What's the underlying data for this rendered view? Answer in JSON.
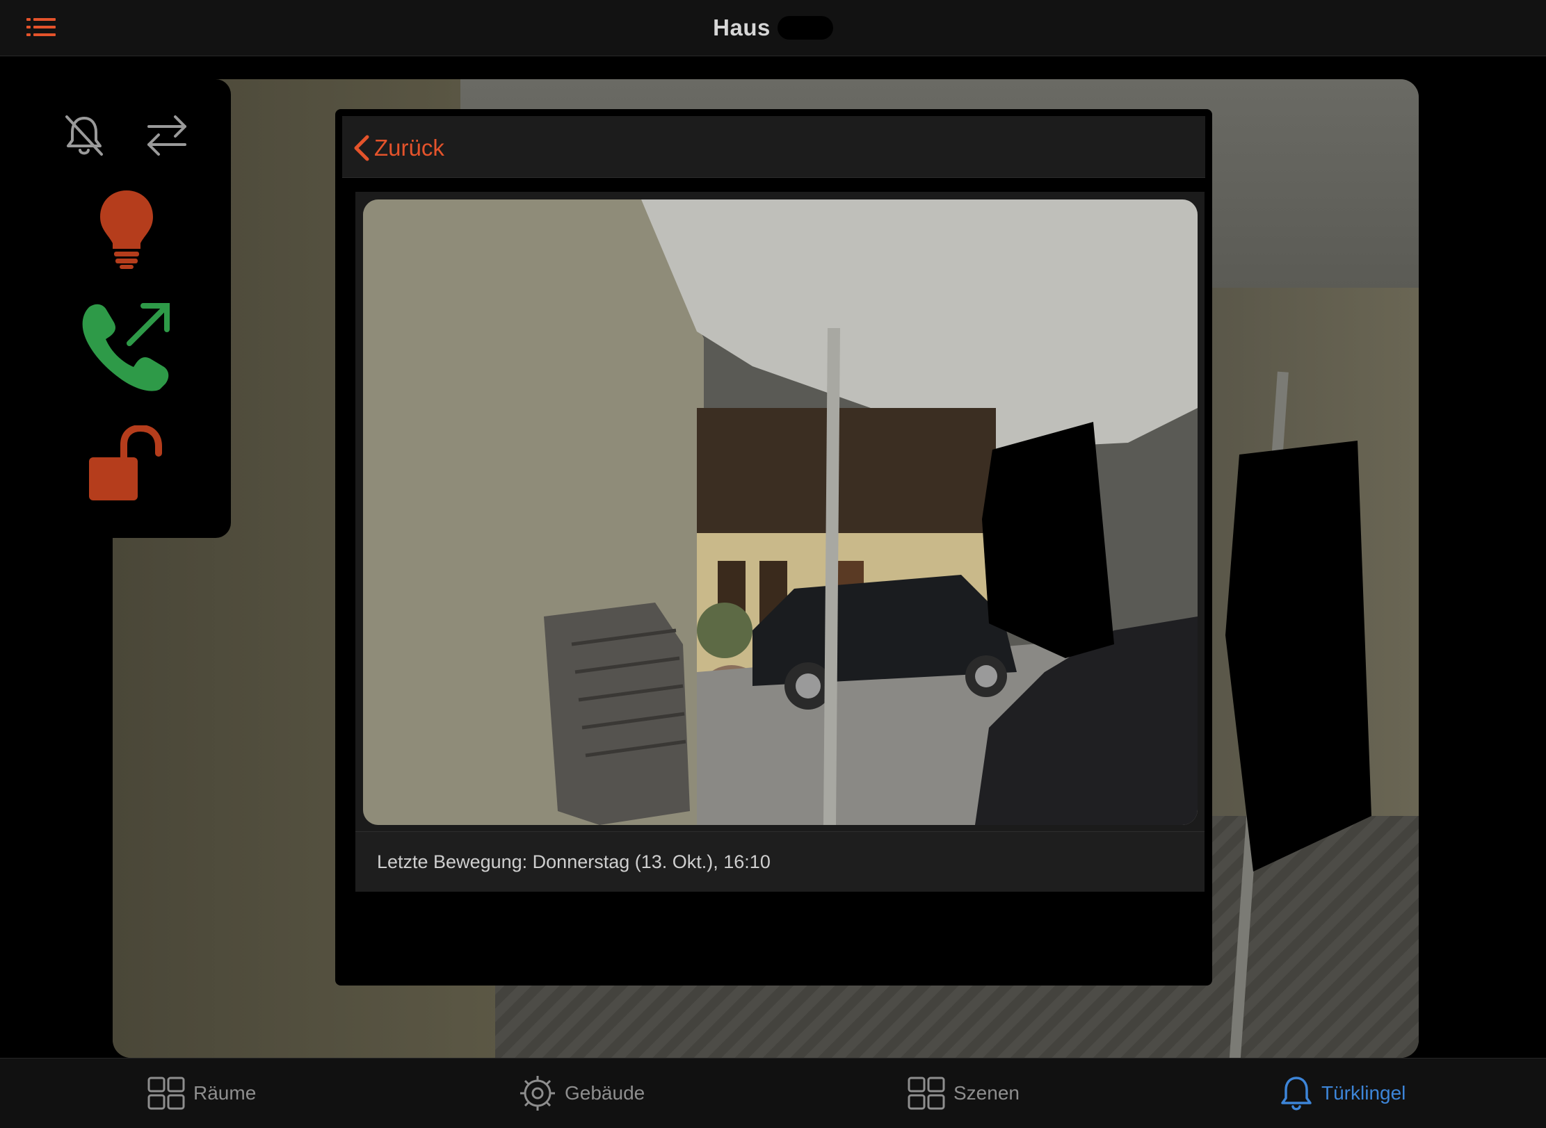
{
  "header": {
    "title": "Haus",
    "menu_icon": "list-icon"
  },
  "side_controls": [
    {
      "name": "bell-muted-icon",
      "color": "#9a9a9a"
    },
    {
      "name": "swap-arrows-icon",
      "color": "#9a9a9a"
    },
    {
      "name": "lightbulb-icon",
      "color": "#b53d1c"
    },
    {
      "name": "phone-outgoing-icon",
      "color": "#2e9a48"
    },
    {
      "name": "unlock-icon",
      "color": "#b53d1c"
    }
  ],
  "modal": {
    "back_label": "Zurück",
    "motion_text": "Letzte Bewegung: Donnerstag (13. Okt.), 16:10"
  },
  "tabbar": {
    "tabs": [
      {
        "label": "Räume",
        "icon": "grid-icon",
        "active": false
      },
      {
        "label": "Gebäude",
        "icon": "gear-icon",
        "active": false
      },
      {
        "label": "Szenen",
        "icon": "grid-icon",
        "active": false
      },
      {
        "label": "Türklingel",
        "icon": "bell-icon",
        "active": true
      }
    ]
  },
  "colors": {
    "accent": "#e4532b",
    "active_tab": "#3d85d8",
    "call_green": "#2e9a48",
    "control_red": "#b53d1c"
  }
}
